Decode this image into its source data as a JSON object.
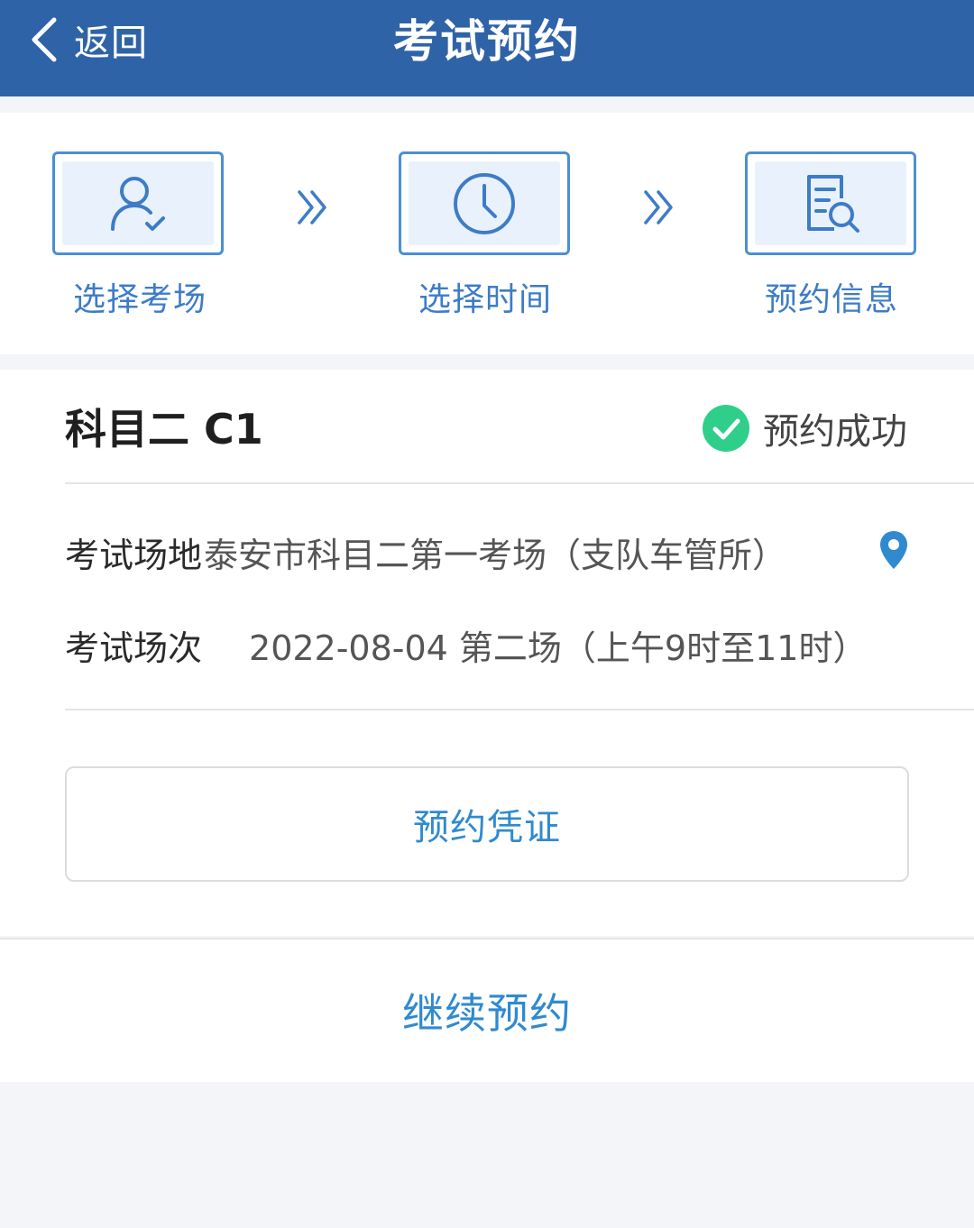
{
  "header": {
    "back_label": "返回",
    "title": "考试预约"
  },
  "steps": [
    {
      "label": "选择考场",
      "icon": "user-check-icon"
    },
    {
      "label": "选择时间",
      "icon": "clock-icon"
    },
    {
      "label": "预约信息",
      "icon": "document-search-icon"
    }
  ],
  "result": {
    "subject": "科目二 C1",
    "status": "预约成功",
    "venue_label": "考试场地",
    "venue_value": "泰安市科目二第一考场（支队车管所）",
    "session_label": "考试场次",
    "session_value": "2022-08-04 第二场（上午9时至11时）",
    "voucher_button": "预约凭证"
  },
  "footer": {
    "continue_button": "继续预约"
  },
  "colors": {
    "navbar": "#2f63a8",
    "step_accent": "#4a8fd6",
    "link": "#2f8ad0",
    "success": "#2fcf8a"
  }
}
